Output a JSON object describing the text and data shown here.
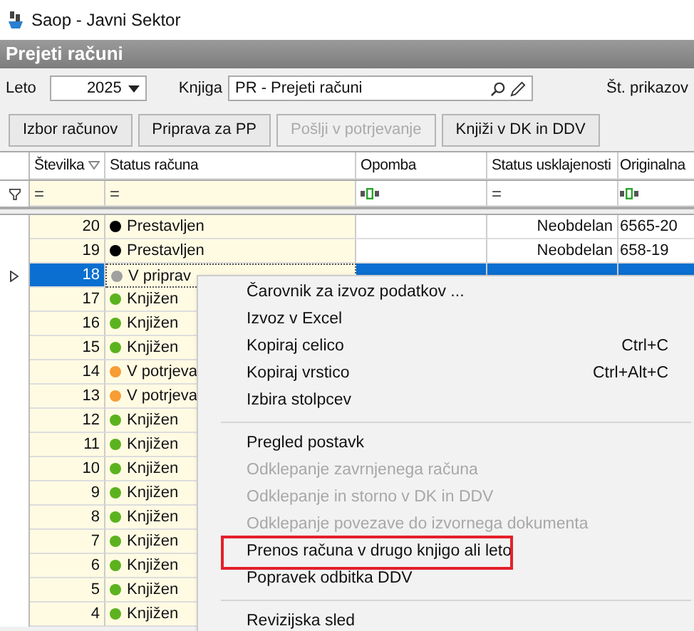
{
  "window": {
    "title": "Saop  - Javni Sektor"
  },
  "panel_title": "Prejeti računi",
  "leto": {
    "label": "Leto",
    "value": "2025"
  },
  "knjiga": {
    "label": "Knjiga",
    "value": "PR - Prejeti računi"
  },
  "shows_label": "Št. prikazov",
  "buttons": [
    {
      "label": "Izbor računov",
      "disabled": false
    },
    {
      "label": "Priprava za PP",
      "disabled": false
    },
    {
      "label": "Pošlji v potrjevanje",
      "disabled": true
    },
    {
      "label": "Knjiži v DK in DDV",
      "disabled": false
    }
  ],
  "table": {
    "columns": [
      {
        "label": "Številka",
        "sorted": true
      },
      {
        "label": "Status računa",
        "sorted": false
      },
      {
        "label": "Opomba",
        "sorted": false
      },
      {
        "label": "Status usklajenosti",
        "sorted": false
      },
      {
        "label": "Originalna",
        "sorted": false
      }
    ],
    "filters": [
      {
        "kind": "equals",
        "text": "="
      },
      {
        "kind": "equals",
        "text": "="
      },
      {
        "kind": "abc"
      },
      {
        "kind": "equals",
        "text": "="
      },
      {
        "kind": "abc"
      }
    ],
    "rows": [
      {
        "number": "20",
        "status": "Prestavljen",
        "color": "#000000",
        "selected": false,
        "reconciliation": "Neobdelan",
        "original": "6565-20"
      },
      {
        "number": "19",
        "status": "Prestavljen",
        "color": "#000000",
        "selected": false,
        "reconciliation": "Neobdelan",
        "original": "658-19"
      },
      {
        "number": "18",
        "status": "V priprav",
        "color": "#a0a0a0",
        "selected": true
      },
      {
        "number": "17",
        "status": "Knjižen",
        "color": "#5cb21e",
        "selected": false
      },
      {
        "number": "16",
        "status": "Knjižen",
        "color": "#5cb21e",
        "selected": false
      },
      {
        "number": "15",
        "status": "Knjižen",
        "color": "#5cb21e",
        "selected": false
      },
      {
        "number": "14",
        "status": "V potrjeva",
        "color": "#f89c34",
        "selected": false
      },
      {
        "number": "13",
        "status": "V potrjeva",
        "color": "#f89c34",
        "selected": false
      },
      {
        "number": "12",
        "status": "Knjižen",
        "color": "#5cb21e",
        "selected": false
      },
      {
        "number": "11",
        "status": "Knjižen",
        "color": "#5cb21e",
        "selected": false
      },
      {
        "number": "10",
        "status": "Knjižen",
        "color": "#5cb21e",
        "selected": false
      },
      {
        "number": "9",
        "status": "Knjižen",
        "color": "#5cb21e",
        "selected": false
      },
      {
        "number": "8",
        "status": "Knjižen",
        "color": "#5cb21e",
        "selected": false
      },
      {
        "number": "7",
        "status": "Knjižen",
        "color": "#5cb21e",
        "selected": false
      },
      {
        "number": "6",
        "status": "Knjižen",
        "color": "#5cb21e",
        "selected": false
      },
      {
        "number": "5",
        "status": "Knjižen",
        "color": "#5cb21e",
        "selected": false
      },
      {
        "number": "4",
        "status": "Knjižen",
        "color": "#5cb21e",
        "selected": false
      }
    ]
  },
  "context_menu": {
    "items": [
      {
        "kind": "item",
        "label": "Čarovnik za izvoz podatkov ...",
        "disabled": false,
        "highlighted": false
      },
      {
        "kind": "item",
        "label": "Izvoz v Excel",
        "disabled": false,
        "highlighted": false
      },
      {
        "kind": "item",
        "label": "Kopiraj celico",
        "shortcut": "Ctrl+C",
        "disabled": false,
        "highlighted": false
      },
      {
        "kind": "item",
        "label": "Kopiraj vrstico",
        "shortcut": "Ctrl+Alt+C",
        "disabled": false,
        "highlighted": false
      },
      {
        "kind": "item",
        "label": "Izbira stolpcev",
        "disabled": false,
        "highlighted": false
      },
      {
        "kind": "separator"
      },
      {
        "kind": "item",
        "label": "Pregled postavk",
        "disabled": false,
        "highlighted": false
      },
      {
        "kind": "item",
        "label": "Odklepanje zavrnjenega računa",
        "disabled": true,
        "highlighted": false
      },
      {
        "kind": "item",
        "label": "Odklepanje in storno v DK in DDV",
        "disabled": true,
        "highlighted": false
      },
      {
        "kind": "item",
        "label": "Odklepanje povezave do izvornega dokumenta",
        "disabled": true,
        "highlighted": false
      },
      {
        "kind": "item",
        "label": "Prenos računa v drugo knjigo ali leto",
        "disabled": false,
        "highlighted": true
      },
      {
        "kind": "item",
        "label": "Popravek odbitka DDV",
        "disabled": false,
        "highlighted": false
      },
      {
        "kind": "separator"
      },
      {
        "kind": "item",
        "label": "Revizijska sled",
        "disabled": false,
        "highlighted": false
      }
    ]
  }
}
